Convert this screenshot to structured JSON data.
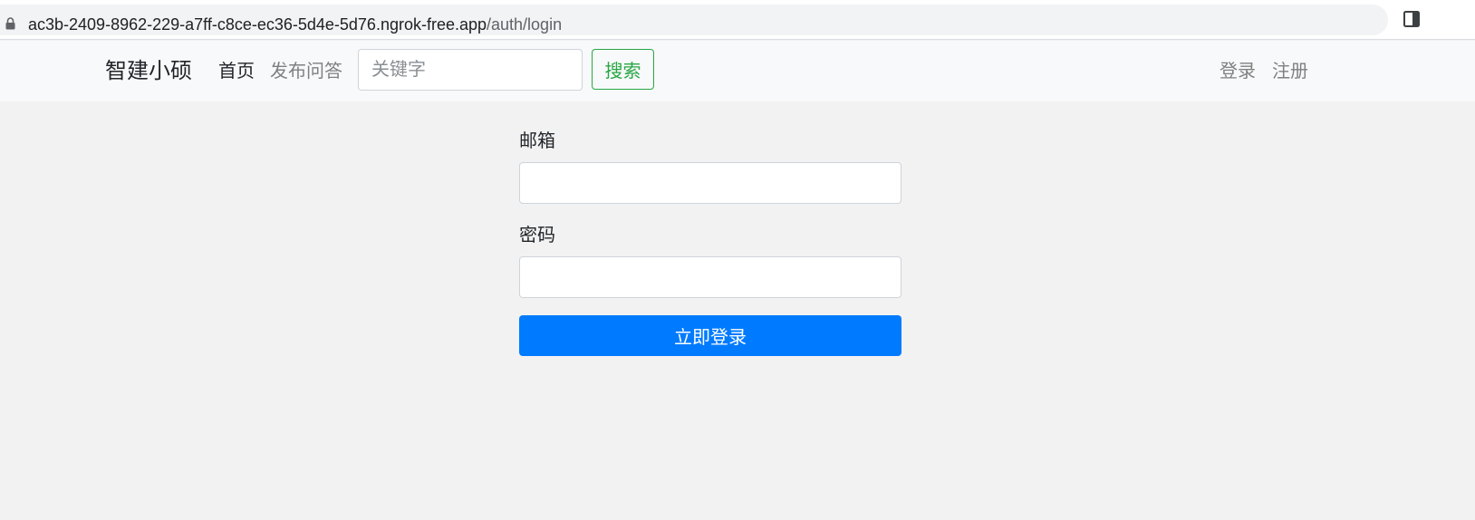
{
  "browser": {
    "url_host": "ac3b-2409-8962-229-a7ff-c8ce-ec36-5d4e-5d76.ngrok-free.app",
    "url_path": "/auth/login",
    "icons": [
      "lock-icon",
      "side-panel-icon"
    ]
  },
  "navbar": {
    "brand": "智建小硕",
    "home": "首页",
    "publish": "发布问答",
    "search_placeholder": "关键字",
    "search_button": "搜索",
    "login": "登录",
    "register": "注册"
  },
  "form": {
    "email_label": "邮箱",
    "email_value": "",
    "password_label": "密码",
    "password_value": "",
    "submit": "立即登录"
  },
  "colors": {
    "page_bg": "#f2f2f2",
    "navbar_bg": "#f8f9fa",
    "primary": "#007bff",
    "success": "#28a745",
    "muted_link": "#808080"
  }
}
